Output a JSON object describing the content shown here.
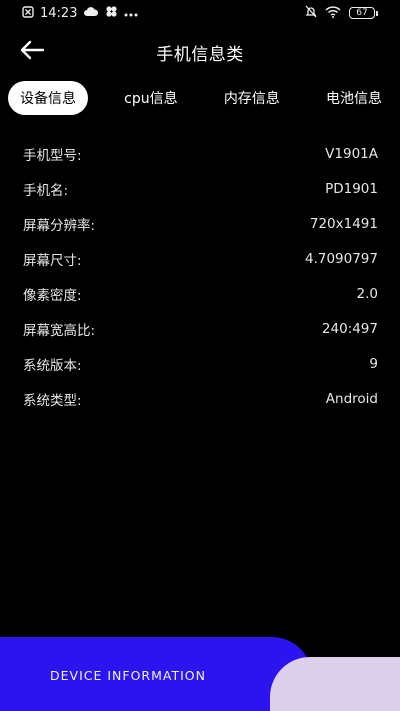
{
  "status_bar": {
    "time": "14:23",
    "battery": "67"
  },
  "header": {
    "title": "手机信息类"
  },
  "tabs": [
    {
      "label": "设备信息",
      "active": true
    },
    {
      "label": "cpu信息",
      "active": false
    },
    {
      "label": "内存信息",
      "active": false
    },
    {
      "label": "电池信息",
      "active": false
    }
  ],
  "info": [
    {
      "label": "手机型号:",
      "value": "V1901A"
    },
    {
      "label": "手机名:",
      "value": "PD1901"
    },
    {
      "label": "屏幕分辨率:",
      "value": "720x1491"
    },
    {
      "label": "屏幕尺寸:",
      "value": "4.7090797"
    },
    {
      "label": "像素密度:",
      "value": "2.0"
    },
    {
      "label": "屏幕宽高比:",
      "value": "240:497"
    },
    {
      "label": "系统版本:",
      "value": "9"
    },
    {
      "label": "系统类型:",
      "value": "Android"
    }
  ],
  "banner": {
    "text": "DEVICE INFORMATION",
    "colors": {
      "primary": "#2c14f0",
      "secondary": "#ddd0ea"
    }
  }
}
